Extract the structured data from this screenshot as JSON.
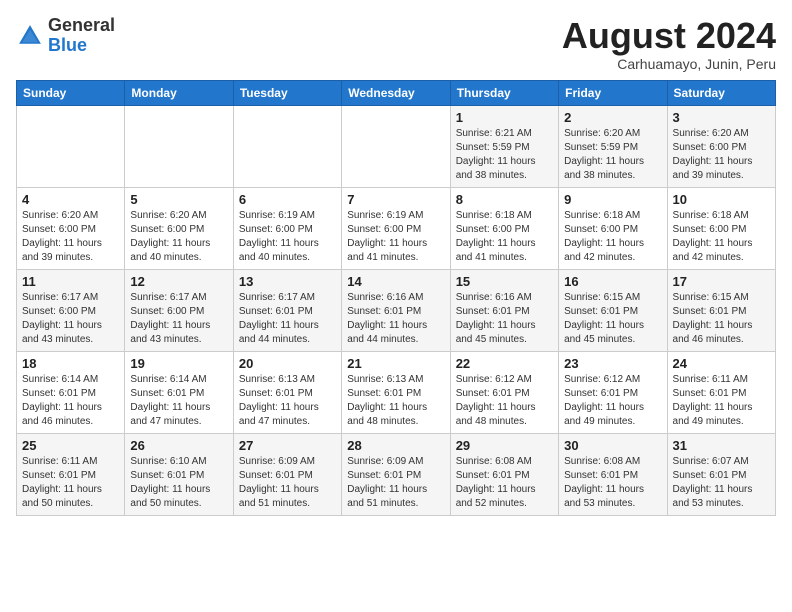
{
  "header": {
    "logo_general": "General",
    "logo_blue": "Blue",
    "month_year": "August 2024",
    "location": "Carhuamayo, Junin, Peru"
  },
  "days_of_week": [
    "Sunday",
    "Monday",
    "Tuesday",
    "Wednesday",
    "Thursday",
    "Friday",
    "Saturday"
  ],
  "weeks": [
    [
      {
        "day": "",
        "info": ""
      },
      {
        "day": "",
        "info": ""
      },
      {
        "day": "",
        "info": ""
      },
      {
        "day": "",
        "info": ""
      },
      {
        "day": "1",
        "info": "Sunrise: 6:21 AM\nSunset: 5:59 PM\nDaylight: 11 hours\nand 38 minutes."
      },
      {
        "day": "2",
        "info": "Sunrise: 6:20 AM\nSunset: 5:59 PM\nDaylight: 11 hours\nand 38 minutes."
      },
      {
        "day": "3",
        "info": "Sunrise: 6:20 AM\nSunset: 6:00 PM\nDaylight: 11 hours\nand 39 minutes."
      }
    ],
    [
      {
        "day": "4",
        "info": "Sunrise: 6:20 AM\nSunset: 6:00 PM\nDaylight: 11 hours\nand 39 minutes."
      },
      {
        "day": "5",
        "info": "Sunrise: 6:20 AM\nSunset: 6:00 PM\nDaylight: 11 hours\nand 40 minutes."
      },
      {
        "day": "6",
        "info": "Sunrise: 6:19 AM\nSunset: 6:00 PM\nDaylight: 11 hours\nand 40 minutes."
      },
      {
        "day": "7",
        "info": "Sunrise: 6:19 AM\nSunset: 6:00 PM\nDaylight: 11 hours\nand 41 minutes."
      },
      {
        "day": "8",
        "info": "Sunrise: 6:18 AM\nSunset: 6:00 PM\nDaylight: 11 hours\nand 41 minutes."
      },
      {
        "day": "9",
        "info": "Sunrise: 6:18 AM\nSunset: 6:00 PM\nDaylight: 11 hours\nand 42 minutes."
      },
      {
        "day": "10",
        "info": "Sunrise: 6:18 AM\nSunset: 6:00 PM\nDaylight: 11 hours\nand 42 minutes."
      }
    ],
    [
      {
        "day": "11",
        "info": "Sunrise: 6:17 AM\nSunset: 6:00 PM\nDaylight: 11 hours\nand 43 minutes."
      },
      {
        "day": "12",
        "info": "Sunrise: 6:17 AM\nSunset: 6:00 PM\nDaylight: 11 hours\nand 43 minutes."
      },
      {
        "day": "13",
        "info": "Sunrise: 6:17 AM\nSunset: 6:01 PM\nDaylight: 11 hours\nand 44 minutes."
      },
      {
        "day": "14",
        "info": "Sunrise: 6:16 AM\nSunset: 6:01 PM\nDaylight: 11 hours\nand 44 minutes."
      },
      {
        "day": "15",
        "info": "Sunrise: 6:16 AM\nSunset: 6:01 PM\nDaylight: 11 hours\nand 45 minutes."
      },
      {
        "day": "16",
        "info": "Sunrise: 6:15 AM\nSunset: 6:01 PM\nDaylight: 11 hours\nand 45 minutes."
      },
      {
        "day": "17",
        "info": "Sunrise: 6:15 AM\nSunset: 6:01 PM\nDaylight: 11 hours\nand 46 minutes."
      }
    ],
    [
      {
        "day": "18",
        "info": "Sunrise: 6:14 AM\nSunset: 6:01 PM\nDaylight: 11 hours\nand 46 minutes."
      },
      {
        "day": "19",
        "info": "Sunrise: 6:14 AM\nSunset: 6:01 PM\nDaylight: 11 hours\nand 47 minutes."
      },
      {
        "day": "20",
        "info": "Sunrise: 6:13 AM\nSunset: 6:01 PM\nDaylight: 11 hours\nand 47 minutes."
      },
      {
        "day": "21",
        "info": "Sunrise: 6:13 AM\nSunset: 6:01 PM\nDaylight: 11 hours\nand 48 minutes."
      },
      {
        "day": "22",
        "info": "Sunrise: 6:12 AM\nSunset: 6:01 PM\nDaylight: 11 hours\nand 48 minutes."
      },
      {
        "day": "23",
        "info": "Sunrise: 6:12 AM\nSunset: 6:01 PM\nDaylight: 11 hours\nand 49 minutes."
      },
      {
        "day": "24",
        "info": "Sunrise: 6:11 AM\nSunset: 6:01 PM\nDaylight: 11 hours\nand 49 minutes."
      }
    ],
    [
      {
        "day": "25",
        "info": "Sunrise: 6:11 AM\nSunset: 6:01 PM\nDaylight: 11 hours\nand 50 minutes."
      },
      {
        "day": "26",
        "info": "Sunrise: 6:10 AM\nSunset: 6:01 PM\nDaylight: 11 hours\nand 50 minutes."
      },
      {
        "day": "27",
        "info": "Sunrise: 6:09 AM\nSunset: 6:01 PM\nDaylight: 11 hours\nand 51 minutes."
      },
      {
        "day": "28",
        "info": "Sunrise: 6:09 AM\nSunset: 6:01 PM\nDaylight: 11 hours\nand 51 minutes."
      },
      {
        "day": "29",
        "info": "Sunrise: 6:08 AM\nSunset: 6:01 PM\nDaylight: 11 hours\nand 52 minutes."
      },
      {
        "day": "30",
        "info": "Sunrise: 6:08 AM\nSunset: 6:01 PM\nDaylight: 11 hours\nand 53 minutes."
      },
      {
        "day": "31",
        "info": "Sunrise: 6:07 AM\nSunset: 6:01 PM\nDaylight: 11 hours\nand 53 minutes."
      }
    ]
  ]
}
